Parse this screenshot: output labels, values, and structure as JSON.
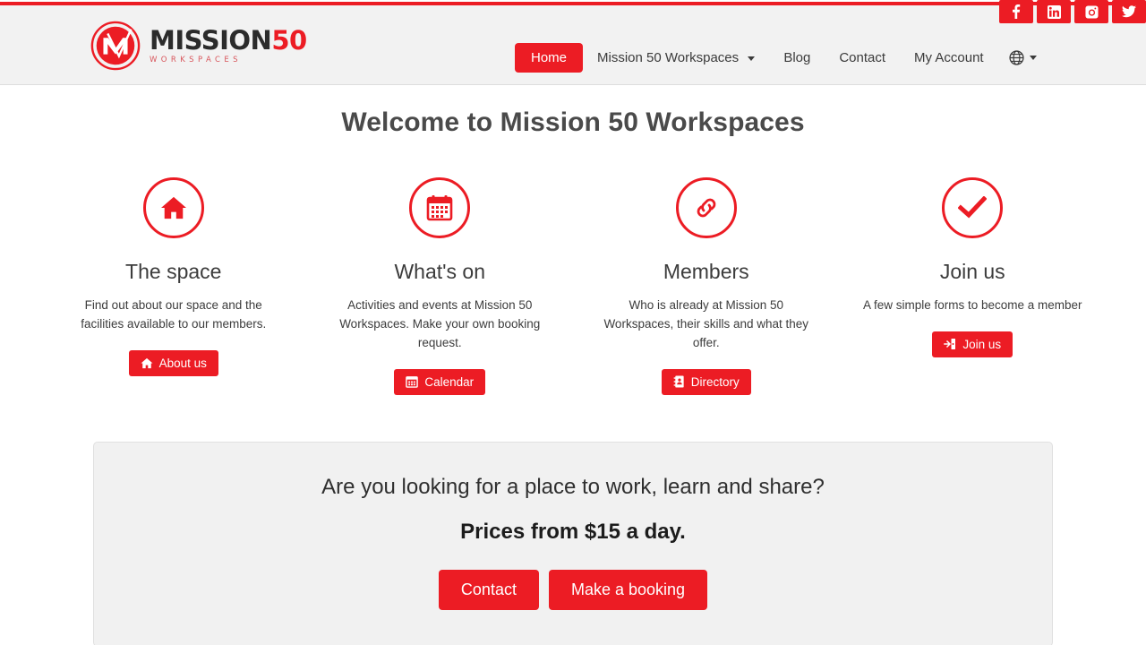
{
  "theme": {
    "accent_red": "#ec1c24",
    "header_bg": "#f2f2f2",
    "panel_bg": "#f1f1f1"
  },
  "header": {
    "logo": {
      "word_dark": "MISSION",
      "word_red": "50",
      "subtitle": "WORKSPACES"
    },
    "social": [
      {
        "name": "facebook",
        "label": "f"
      },
      {
        "name": "linkedin",
        "label": "in"
      },
      {
        "name": "instagram",
        "label": "instagram"
      },
      {
        "name": "twitter",
        "label": "twitter"
      }
    ],
    "nav": [
      {
        "label": "Home",
        "active": true,
        "dropdown": false
      },
      {
        "label": "Mission 50 Workspaces",
        "active": false,
        "dropdown": true
      },
      {
        "label": "Blog",
        "active": false,
        "dropdown": false
      },
      {
        "label": "Contact",
        "active": false,
        "dropdown": false
      },
      {
        "label": "My Account",
        "active": false,
        "dropdown": false
      }
    ],
    "language_selector": "globe"
  },
  "main": {
    "title": "Welcome to Mission 50 Workspaces",
    "features": [
      {
        "icon": "home-icon",
        "title": "The space",
        "description": "Find out about our space and the facilities available to our members.",
        "button": {
          "label": "About us",
          "icon": "home-icon"
        }
      },
      {
        "icon": "calendar-icon",
        "title": "What's on",
        "description": "Activities and events at Mission 50 Workspaces. Make your own booking request.",
        "button": {
          "label": "Calendar",
          "icon": "calendar-icon"
        }
      },
      {
        "icon": "link-icon",
        "title": "Members",
        "description": "Who is already at Mission 50 Workspaces, their skills and what they offer.",
        "button": {
          "label": "Directory",
          "icon": "address-book-icon"
        }
      },
      {
        "icon": "check-icon",
        "title": "Join us",
        "description": "A few simple forms to become a member",
        "button": {
          "label": "Join us",
          "icon": "sign-in-icon"
        }
      }
    ],
    "cta": {
      "question": "Are you looking for a place to work, learn and share?",
      "price": "Prices from $15 a day.",
      "buttons": [
        {
          "label": "Contact"
        },
        {
          "label": "Make a booking"
        }
      ]
    }
  }
}
